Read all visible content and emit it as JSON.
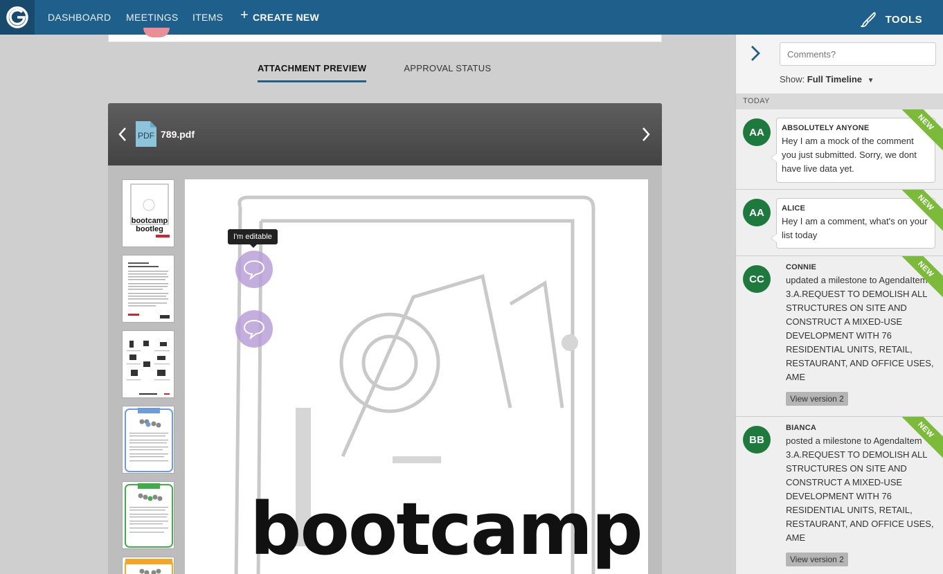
{
  "nav": {
    "items": [
      "DASHBOARD",
      "MEETINGS",
      "ITEMS"
    ],
    "create_label": "CREATE NEW",
    "tools_label": "TOOLS"
  },
  "tabs": [
    "ATTACHMENT PREVIEW",
    "APPROVAL STATUS"
  ],
  "viewer": {
    "file_type": "PDF",
    "file_name": "789.pdf",
    "tooltip": "I'm editable",
    "page_heading": "bootcamp",
    "thumbnail_heading": "bootcamp bootleg"
  },
  "sidebar": {
    "comment_placeholder": "Comments?",
    "show_label": "Show:",
    "show_value": "Full Timeline",
    "section_label": "TODAY",
    "badge_label": "NEW",
    "entries": [
      {
        "initials": "AA",
        "name": "ABSOLUTELY ANYONE",
        "text": "Hey I am a mock of the comment you just submitted. Sorry, we dont have live data yet."
      },
      {
        "initials": "AA",
        "name": "ALICE",
        "text": "Hey I am a comment, what's on your list today"
      },
      {
        "initials": "CC",
        "name": "CONNIE",
        "text": "updated a milestone to AgendaItem 3.A.REQUEST TO DEMOLISH ALL STRUCTURES ON SITE AND CONSTRUCT A MIXED-USE DEVELOPMENT WITH 76 RESIDENTIAL UNITS, RETAIL, RESTAURANT, AND OFFICE USES, AME",
        "button": "View version 2"
      },
      {
        "initials": "BB",
        "name": "BIANCA",
        "text": "posted a milestone to AgendaItem 3.A.REQUEST TO DEMOLISH ALL STRUCTURES ON SITE AND CONSTRUCT A MIXED-USE DEVELOPMENT WITH 76 RESIDENTIAL UNITS, RETAIL, RESTAURANT, AND OFFICE USES, AME",
        "button": "View version 2"
      }
    ]
  },
  "colors": {
    "nav": "#1f5f8b",
    "avatar": "#1d7a3c",
    "new_badge": "#7cba3a",
    "comment_pin": "#b8a0d8"
  }
}
